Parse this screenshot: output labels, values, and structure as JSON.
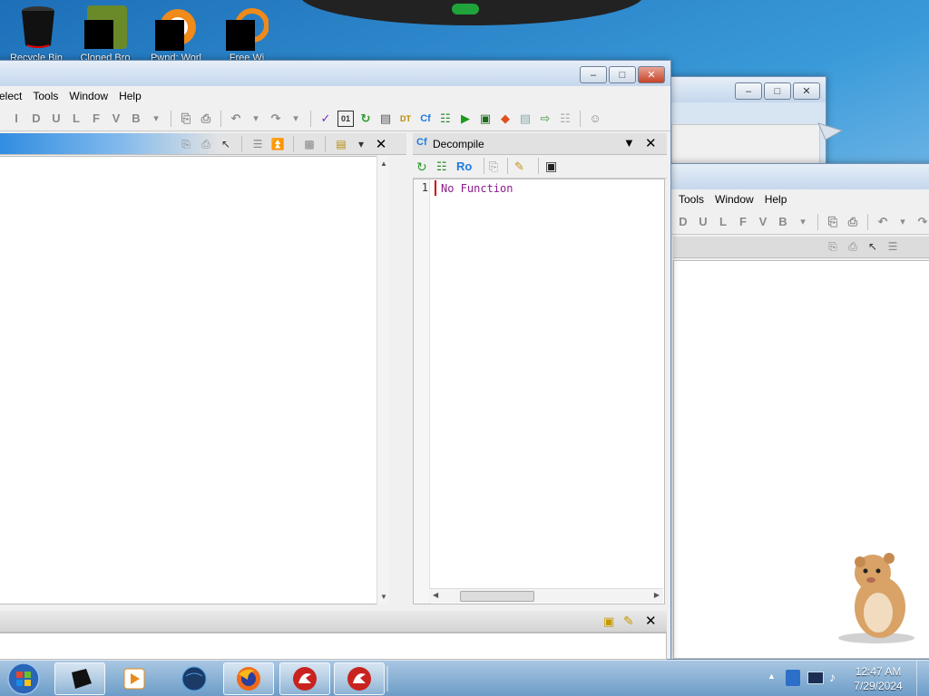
{
  "desktop": {
    "icons": [
      {
        "label": "Recycle Bin",
        "icon": "recycle-bin-icon"
      },
      {
        "label": "Cloned Bro",
        "icon": "game-icon"
      },
      {
        "label": "Pwnd: Worl",
        "icon": "app-icon"
      },
      {
        "label": "Free Wi",
        "icon": "app-icon"
      }
    ]
  },
  "front_window": {
    "menu": [
      "elect",
      "Tools",
      "Window",
      "Help"
    ],
    "toolbar_letters": [
      "I",
      "D",
      "U",
      "L",
      "F",
      "V",
      "B"
    ],
    "decompile": {
      "title": "Decompile",
      "toolbar_text": "Ro",
      "line_number": "1",
      "code": "No Function"
    }
  },
  "back_window": {
    "menu": [
      "Tools",
      "Window",
      "Help"
    ],
    "toolbar_letters": [
      "D",
      "U",
      "L",
      "F",
      "V",
      "B"
    ]
  },
  "taskbar": {
    "time": "12:47 AM",
    "date": "7/29/2024"
  },
  "colors": {
    "code_keyword": "#8b1a8b",
    "cursor": "#cc0000",
    "accent_blue": "#1e7be0"
  }
}
